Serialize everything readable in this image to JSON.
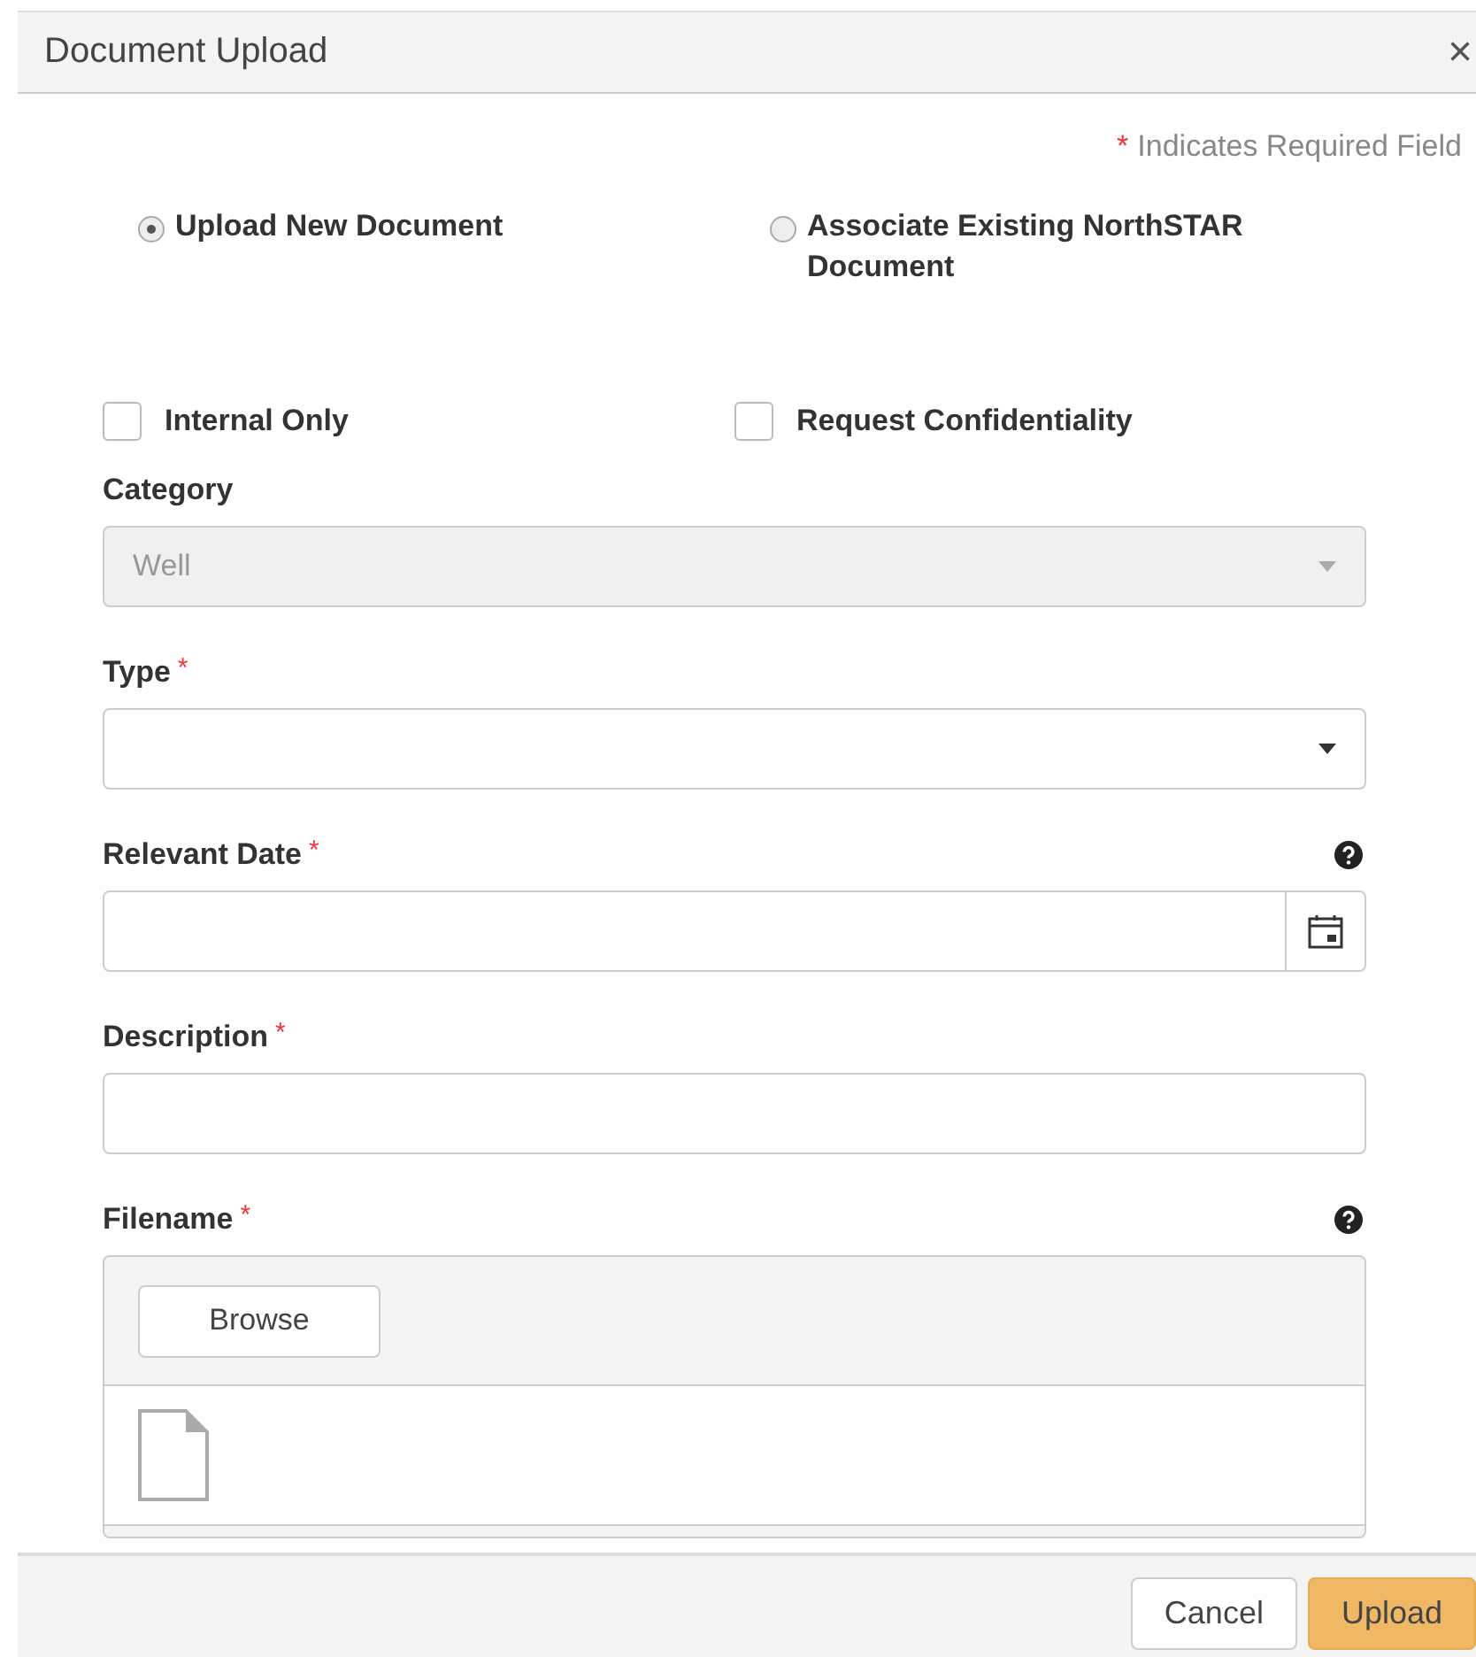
{
  "window": {
    "title": "Document Upload",
    "close": "×"
  },
  "legend": {
    "mark": "*",
    "text": "Indicates Required Field"
  },
  "sources": [
    {
      "label": "Upload New Document",
      "selected": true
    },
    {
      "label": "Associate Existing NorthSTAR Document",
      "selected": false
    }
  ],
  "options": [
    {
      "label": "Internal Only",
      "checked": false
    },
    {
      "label": "Request Confidentiality",
      "checked": false
    }
  ],
  "fields": [
    {
      "kind": "select",
      "label": "Category",
      "value": "Well",
      "disabled": true,
      "required": false,
      "help": false
    },
    {
      "kind": "select",
      "label": "Type",
      "disabled": false,
      "required": true,
      "help": false
    },
    {
      "kind": "date",
      "label": "Relevant Date",
      "disabled": false,
      "required": true,
      "help": true
    },
    {
      "kind": "text",
      "label": "Description",
      "disabled": false,
      "required": true,
      "help": false
    },
    {
      "kind": "file",
      "label": "Filename",
      "button": "Browse",
      "disabled": false,
      "required": true,
      "help": true
    }
  ],
  "buttons": [
    {
      "label": "Cancel",
      "kind": "default"
    },
    {
      "label": "Upload",
      "kind": "primary"
    }
  ]
}
